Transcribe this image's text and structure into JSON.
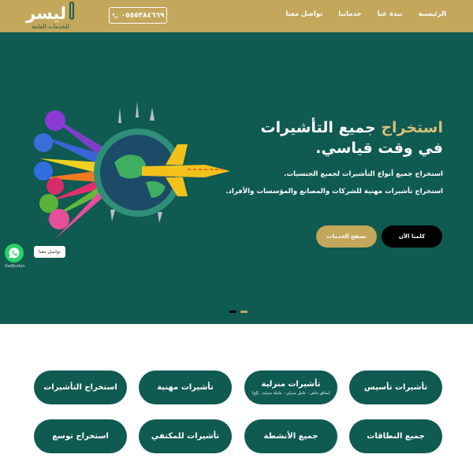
{
  "header": {
    "logo_main": "ليسر",
    "logo_sub": "للخدمات العامة",
    "phone": "٠٥٥٥٣٨٤٦٦٩",
    "nav": [
      "الرئيسية",
      "نبذة عنا",
      "خدماتنا",
      "تواصل معنا"
    ]
  },
  "hero": {
    "title_accent": "استخراج",
    "title_rest": "جميع التأشيرات",
    "title_line2": "في وقت قياسي.",
    "line1": "استخراج جميع أنواع التأشيرات لجميع الجنسيات.",
    "line2": "استخراج تأشيرات مهنية للشركات والمصانع والمؤسسات والأفراد.",
    "btn_contact": "كلمنا الآن",
    "btn_services": "تصفح الخدمات"
  },
  "whatsapp": {
    "tooltip": "تواصل معنا",
    "brand": "GetButton"
  },
  "services": [
    {
      "label": "تأشيرات تأسيس",
      "sub": ""
    },
    {
      "label": "تأشيرات منزلية",
      "sub": "(سائق خاص - عامل منزلي - عاملة منزلية ..إلخ)"
    },
    {
      "label": "تأشيرات مهنية",
      "sub": ""
    },
    {
      "label": "استخراج التأشيرات",
      "sub": ""
    },
    {
      "label": "جميع النطاقات",
      "sub": ""
    },
    {
      "label": "جميع الأنشطة",
      "sub": ""
    },
    {
      "label": "تأشيرات للمكتفي",
      "sub": ""
    },
    {
      "label": "استخراج توسع",
      "sub": ""
    }
  ],
  "colors": {
    "gold": "#c3a75b",
    "teal": "#0f5a51",
    "accent_text": "#d7bf79"
  }
}
